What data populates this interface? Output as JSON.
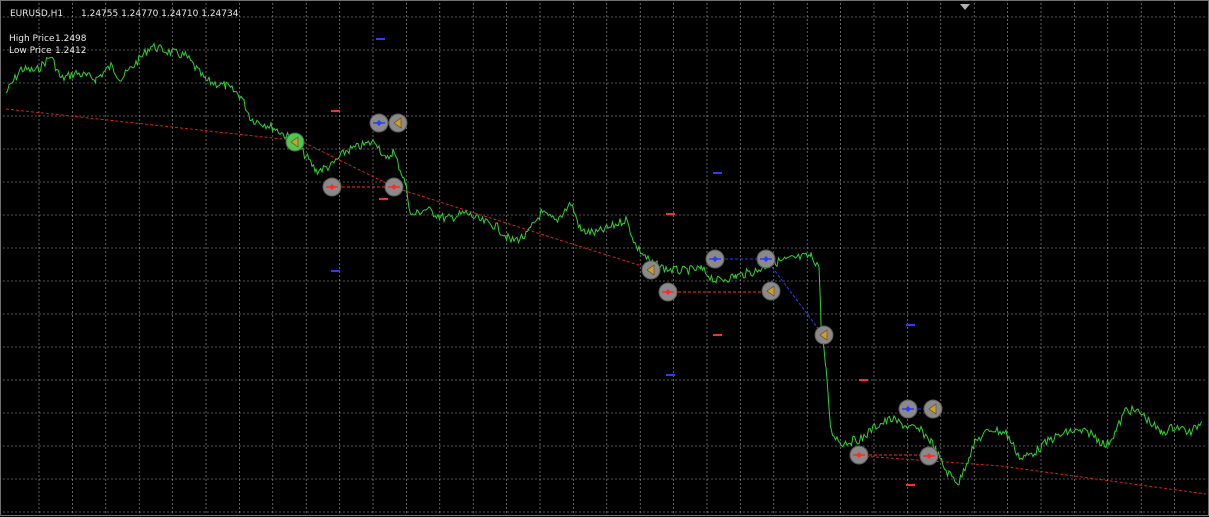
{
  "header": {
    "symbol_timeframe": "EURUSD,H1",
    "ohlc": "1.24755 1.24770 1.24710 1.24734"
  },
  "info": {
    "high_label": "High Price",
    "high_value": "1.2498",
    "low_label": "Low Price",
    "low_value": "1.2412"
  },
  "colors": {
    "background": "#000000",
    "grid": "#c8c8c8",
    "price_line": "#2fd12f",
    "buy": "#2a3cff",
    "sell": "#ff2a2a",
    "trend": "#d42020",
    "marker_ring": "#8a8a8a",
    "close_marker": "#c8a030"
  },
  "icons": {
    "buy_marker": "blue-diamond-arrow-icon",
    "sell_marker": "red-diamond-arrow-icon",
    "close_marker": "close-triangle-icon",
    "chart_shift": "chart-shift-triangle-icon"
  }
}
